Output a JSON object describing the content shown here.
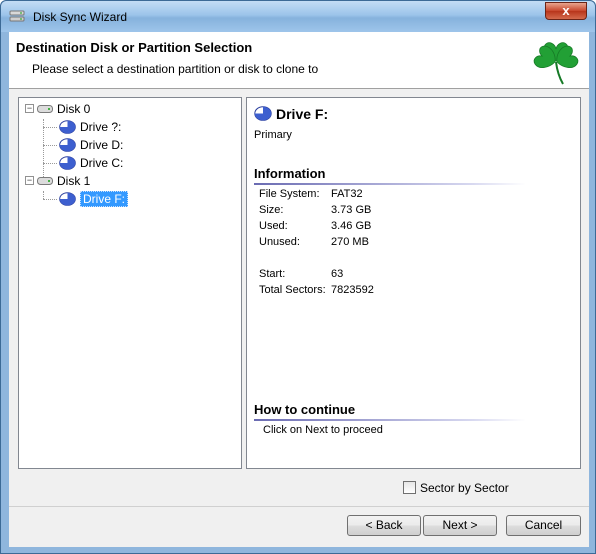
{
  "window": {
    "title": "Disk Sync Wizard",
    "close_glyph": "x"
  },
  "header": {
    "title": "Destination Disk or Partition Selection",
    "subtitle": "Please select a destination partition or disk to clone to",
    "logo_icon": "clover-icon",
    "logo_color": "#22a035"
  },
  "tree": {
    "disks": [
      {
        "label": "Disk 0",
        "partitions": [
          "Drive ?:",
          "Drive D:",
          "Drive C:"
        ]
      },
      {
        "label": "Disk 1",
        "partitions": [
          "Drive F:"
        ]
      }
    ],
    "selected": "Drive F:"
  },
  "details": {
    "drive_name": "Drive F:",
    "drive_type": "Primary",
    "information_heading": "Information",
    "fields": [
      {
        "label": "File System:",
        "value": "FAT32"
      },
      {
        "label": "Size:",
        "value": "3.73 GB"
      },
      {
        "label": "Used:",
        "value": "3.46 GB"
      },
      {
        "label": "Unused:",
        "value": "270 MB"
      },
      {
        "label": "Start:",
        "value": "63"
      },
      {
        "label": "Total Sectors:",
        "value": "7823592"
      }
    ],
    "continue_heading": "How to continue",
    "continue_text": "Click on Next to proceed"
  },
  "options": {
    "sector_by_sector_label": "Sector by Sector",
    "sector_by_sector_checked": false
  },
  "buttons": {
    "back": "< Back",
    "next": "Next >",
    "cancel": "Cancel"
  },
  "colors": {
    "selection": "#3399ff",
    "heading_line": "#6a6bb2",
    "title_bar": "#9cc4ea"
  }
}
